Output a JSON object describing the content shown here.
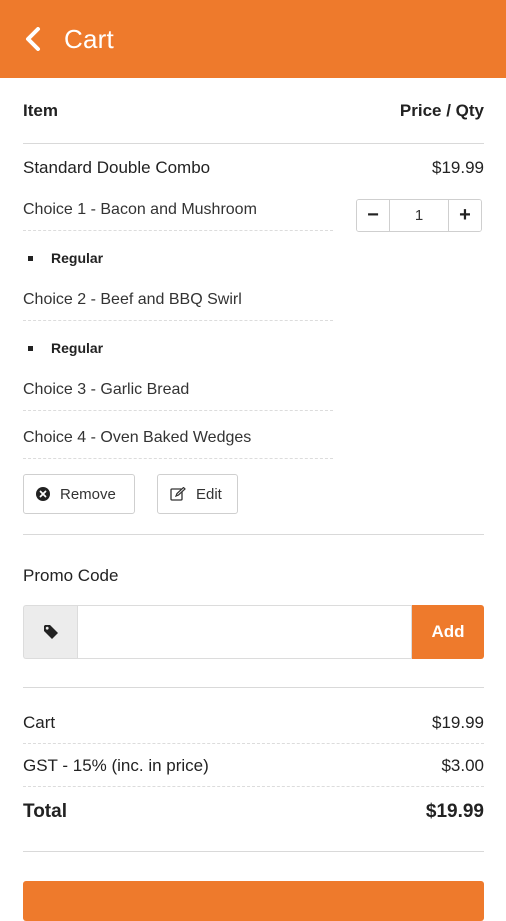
{
  "header": {
    "title": "Cart"
  },
  "table": {
    "col_item": "Item",
    "col_price_qty": "Price / Qty"
  },
  "cart_item": {
    "name": "Standard Double Combo",
    "price": "$19.99",
    "quantity": "1",
    "choices": [
      {
        "label": "Choice 1 - Bacon and Mushroom",
        "option": "Regular"
      },
      {
        "label": "Choice 2 - Beef and BBQ Swirl",
        "option": "Regular"
      },
      {
        "label": "Choice 3 - Garlic Bread"
      },
      {
        "label": "Choice 4 - Oven Baked Wedges"
      }
    ],
    "remove_label": "Remove",
    "edit_label": "Edit"
  },
  "promo": {
    "label": "Promo Code",
    "input_value": "",
    "placeholder": "",
    "add_label": "Add"
  },
  "summary": {
    "cart_label": "Cart",
    "cart_value": "$19.99",
    "gst_label": "GST - 15% (inc. in price)",
    "gst_value": "$3.00",
    "total_label": "Total",
    "total_value": "$19.99"
  },
  "icons": {
    "back": "chevron-left-icon",
    "remove": "times-circle-icon",
    "edit": "edit-icon",
    "promo": "tag-icon"
  },
  "colors": {
    "accent": "#EE7A2C",
    "text": "#222222",
    "divider": "#d9d9d9"
  }
}
